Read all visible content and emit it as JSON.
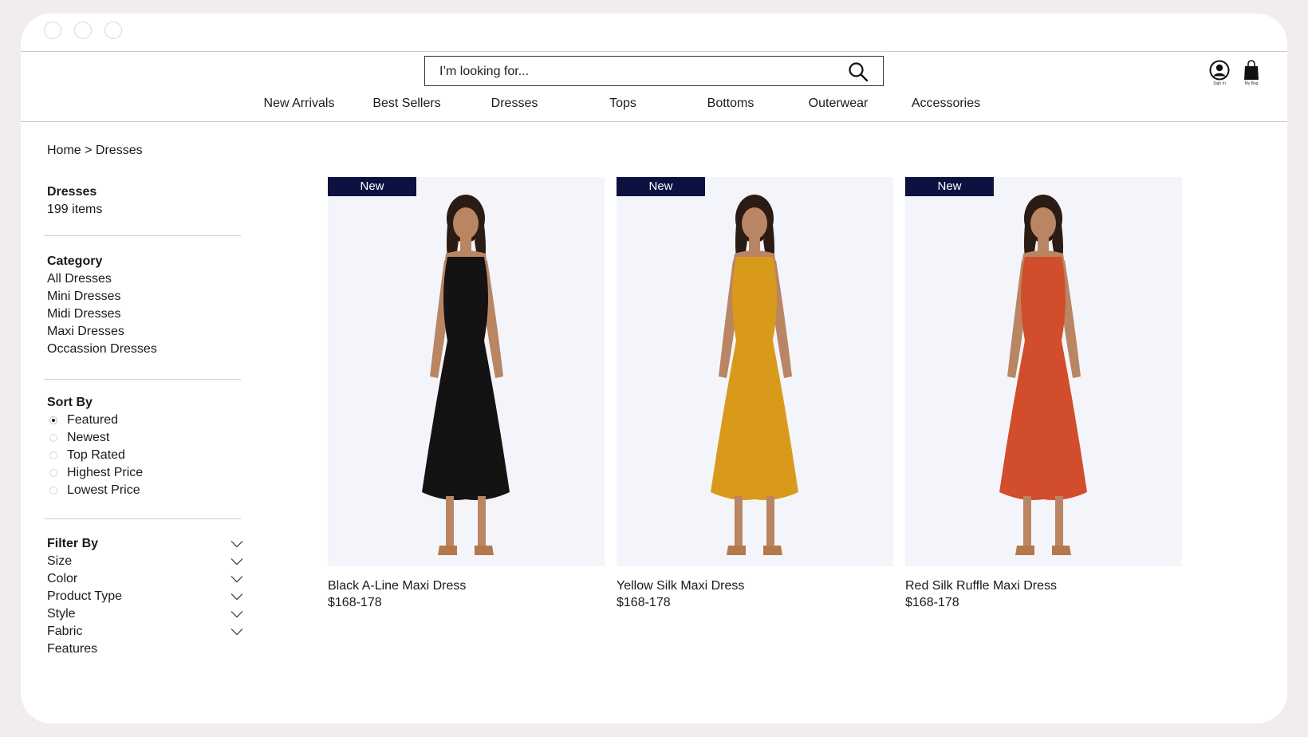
{
  "search": {
    "placeholder": "I’m looking for..."
  },
  "nav": [
    {
      "label": "New Arrivals"
    },
    {
      "label": "Best Sellers"
    },
    {
      "label": "Dresses"
    },
    {
      "label": "Tops"
    },
    {
      "label": "Bottoms"
    },
    {
      "label": "Outerwear"
    },
    {
      "label": "Accessories"
    }
  ],
  "user": {
    "sign_in": "Sign In",
    "bag": "My Bag"
  },
  "breadcrumb": {
    "home": "Home",
    "sep": " > ",
    "current": "Dresses"
  },
  "summary": {
    "title": "Dresses",
    "count": "199 items"
  },
  "category": {
    "title": "Category",
    "items": [
      "All Dresses",
      "Mini Dresses",
      "Midi Dresses",
      "Maxi Dresses",
      "Occassion Dresses"
    ]
  },
  "sort": {
    "title": "Sort By",
    "options": [
      "Featured",
      "Newest",
      "Top Rated",
      "Highest Price",
      "Lowest Price"
    ],
    "selected": "Featured"
  },
  "filter": {
    "title": "Filter By",
    "items": [
      "Size",
      "Color",
      "Product Type",
      "Style",
      "Fabric",
      "Features"
    ]
  },
  "products": [
    {
      "badge": "New",
      "name": "Black A-Line Maxi Dress",
      "price": "$168-178",
      "dress_color": "#151214"
    },
    {
      "badge": "New",
      "name": "Yellow Silk Maxi Dress",
      "price": "$168-178",
      "dress_color": "#d99a1c"
    },
    {
      "badge": "New",
      "name": "Red Silk Ruffle Maxi Dress",
      "price": "$168-178",
      "dress_color": "#d24d2c"
    }
  ],
  "colors": {
    "badge_bg": "#0b1240",
    "image_bg": "#f4f5fa",
    "skin": "#b98563",
    "hair": "#2a1c15",
    "shoe": "#b5784a"
  }
}
